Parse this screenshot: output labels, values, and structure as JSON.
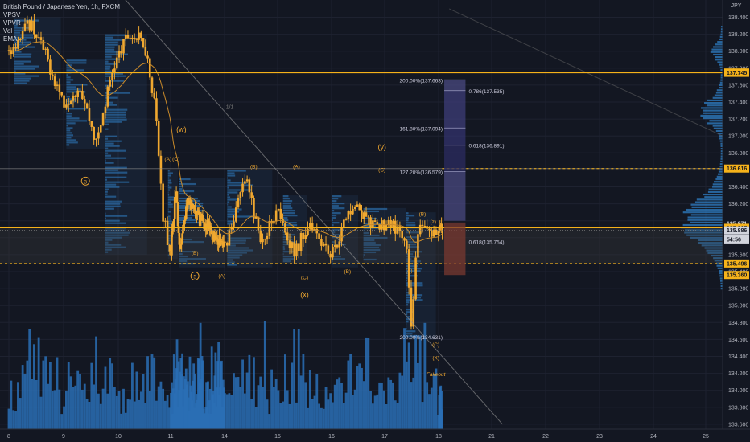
{
  "legend": {
    "symbol": "British Pound / Japanese Yen, 1h, FXCM",
    "indicators": [
      "VPSV",
      "VPVR",
      "Vol",
      "EMA"
    ]
  },
  "currency": "JPY",
  "colors": {
    "background": "#131722",
    "candle": "#f0a830",
    "ema": "#c98a2a",
    "volume": "#2a6fb5",
    "gold_line": "#f5b21a",
    "fib_upper": "#3a3a78",
    "fib_lower": "#7a3a30",
    "label_text": "#f0a830"
  },
  "chart_data": {
    "type": "candlestick",
    "x_ticks": [
      "8",
      "9",
      "10",
      "11",
      "14",
      "15",
      "16",
      "17",
      "18",
      "21",
      "22",
      "23",
      "24",
      "25"
    ],
    "y_ticks": [
      "138.400",
      "138.200",
      "138.000",
      "137.800",
      "137.600",
      "137.400",
      "137.200",
      "137.000",
      "136.800",
      "136.600",
      "136.400",
      "136.200",
      "136.000",
      "135.800",
      "135.600",
      "135.400",
      "135.200",
      "135.000",
      "134.800",
      "134.600",
      "134.400",
      "134.200",
      "134.000",
      "133.800",
      "133.600"
    ],
    "price_labels": [
      {
        "text": "137.749",
        "price": 137.749
      },
      {
        "text": "137.745",
        "price": 137.745
      },
      {
        "text": "136.616",
        "price": 136.616
      },
      {
        "text": "135.971",
        "price": 135.971
      },
      {
        "text": "135.917",
        "price": 135.917
      },
      {
        "text": "135.886",
        "price": 135.886
      },
      {
        "text": "54:56",
        "price": 135.78
      },
      {
        "text": "135.496",
        "price": 135.496
      },
      {
        "text": "135.360",
        "price": 135.36
      }
    ],
    "horizontal_lines": [
      137.749,
      136.616,
      135.917,
      135.496
    ],
    "fib_levels": [
      {
        "text": "200.00%(137.663)",
        "price": 137.663,
        "side": "left"
      },
      {
        "text": "0.786(137.535)",
        "price": 137.535,
        "side": "right"
      },
      {
        "text": "161.80%(137.094)",
        "price": 137.094,
        "side": "left"
      },
      {
        "text": "0.618(136.891)",
        "price": 136.891,
        "side": "right"
      },
      {
        "text": "127.20%(136.579)",
        "price": 136.579,
        "side": "left"
      },
      {
        "text": "0.618(135.754)",
        "price": 135.754,
        "side": "right"
      },
      {
        "text": "200.00%(134.631)",
        "price": 134.631,
        "side": "left"
      }
    ],
    "wave_labels": [
      {
        "text": "3",
        "circled": true,
        "day": 9.4,
        "price": 136.44
      },
      {
        "text": "(w)",
        "day": 11.2,
        "price": 137.05
      },
      {
        "text": "(A)",
        "day": 10.95,
        "price": 136.71
      },
      {
        "text": "(C)",
        "day": 11.1,
        "price": 136.71
      },
      {
        "text": "(B)",
        "day": 11.45,
        "price": 135.6
      },
      {
        "text": "5",
        "circled": true,
        "day": 11.45,
        "price": 135.32
      },
      {
        "text": "(A)",
        "day": 11.95,
        "price": 135.33
      },
      {
        "text": "(B)",
        "day": 12.55,
        "price": 136.62
      },
      {
        "text": "(A)",
        "day": 13.35,
        "price": 136.62
      },
      {
        "text": "(C)",
        "day": 13.5,
        "price": 135.31
      },
      {
        "text": "(x)",
        "day": 13.5,
        "price": 135.1
      },
      {
        "text": "(B)",
        "day": 14.3,
        "price": 135.38
      },
      {
        "text": "(y)",
        "day": 14.95,
        "price": 136.84
      },
      {
        "text": "(C)",
        "day": 14.95,
        "price": 136.58
      },
      {
        "text": "(A)",
        "day": 15.45,
        "price": 135.39
      },
      {
        "text": "(B)",
        "day": 15.7,
        "price": 136.06
      },
      {
        "text": "(z)",
        "day": 15.9,
        "price": 135.97
      },
      {
        "text": "(C)",
        "day": 15.95,
        "price": 134.52
      },
      {
        "text": "(X)",
        "day": 15.95,
        "price": 134.36
      },
      {
        "text": "1/1",
        "day": 12.1,
        "price": 137.32
      },
      {
        "text": "Fakeout",
        "day": 15.95,
        "price": 134.17
      }
    ],
    "volume_scale": "relative"
  }
}
